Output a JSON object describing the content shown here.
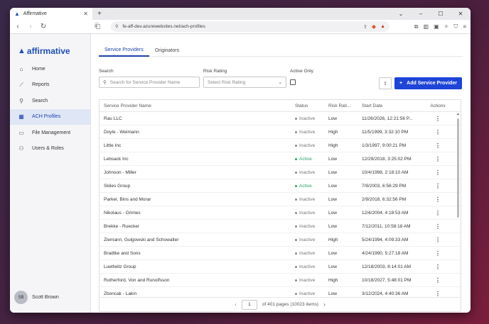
{
  "browser": {
    "tab_title": "Affirmative",
    "url": "fe-aff-dev.azurewebsites.net/ach-profiles"
  },
  "app": {
    "logo_text": "affirmative"
  },
  "sidebar": {
    "items": [
      {
        "label": "Home",
        "icon": "home-icon"
      },
      {
        "label": "Reports",
        "icon": "chart-icon"
      },
      {
        "label": "Search",
        "icon": "search-icon"
      },
      {
        "label": "ACH Profiles",
        "icon": "building-icon"
      },
      {
        "label": "File Management",
        "icon": "file-icon"
      },
      {
        "label": "Users & Roles",
        "icon": "users-icon"
      }
    ],
    "user": {
      "initials": "SB",
      "name": "Scott Brown"
    }
  },
  "tabs": [
    "Service Providers",
    "Originators"
  ],
  "filters": {
    "search_label": "Search",
    "search_placeholder": "Search for Service Provider Name",
    "risk_label": "Risk Rating",
    "risk_placeholder": "Select Risk Rating",
    "active_label": "Active Only"
  },
  "add_button": "Add Service Provider",
  "table": {
    "headers": [
      "Service Provider Name",
      "Status",
      "Risk Rati...",
      "Start Date",
      "Actions"
    ],
    "rows": [
      [
        "Rau LLC",
        "Inactive",
        "Low",
        "11/26/2026, 12:21:56 P..."
      ],
      [
        "Doyle - Weimann",
        "Inactive",
        "High",
        "11/5/1999, 3:32:10 PM"
      ],
      [
        "Little Inc",
        "Inactive",
        "High",
        "1/3/1997, 9:00:21 PM"
      ],
      [
        "Lebsack Inc",
        "Active",
        "Low",
        "12/29/2018, 3:25:02 PM"
      ],
      [
        "Johnson - Miller",
        "Inactive",
        "Low",
        "10/4/1998, 2:18:10 AM"
      ],
      [
        "Skiles Group",
        "Active",
        "Low",
        "7/9/2003, 6:56:29 PM"
      ],
      [
        "Parker, Bins and Morar",
        "Inactive",
        "Low",
        "2/9/2018, 6:32:56 PM"
      ],
      [
        "Nikolaus - Grimes",
        "Inactive",
        "Low",
        "12/4/2004, 4:18:53 AM"
      ],
      [
        "Brekke - Ruecker",
        "Inactive",
        "Low",
        "7/12/2011, 10:58:18 AM"
      ],
      [
        "Ziemann, Gulgowski and Schowalter",
        "Inactive",
        "High",
        "5/24/1994, 4:09:33 AM"
      ],
      [
        "Bradtke and Sons",
        "Inactive",
        "Low",
        "4/24/1990, 5:27:18 AM"
      ],
      [
        "Luettwitz Group",
        "Inactive",
        "Low",
        "12/18/2003, 8:14:01 AM"
      ],
      [
        "Rutherford, Von and Runolfsson",
        "Inactive",
        "High",
        "10/18/2027, 5:48:01 PM"
      ],
      [
        "Zboncak - Lakin",
        "Inactive",
        "Low",
        "3/12/2024, 4:40:36 AM"
      ]
    ]
  },
  "pager": {
    "page": "1",
    "summary": "of 401 pages (10023 items)"
  }
}
